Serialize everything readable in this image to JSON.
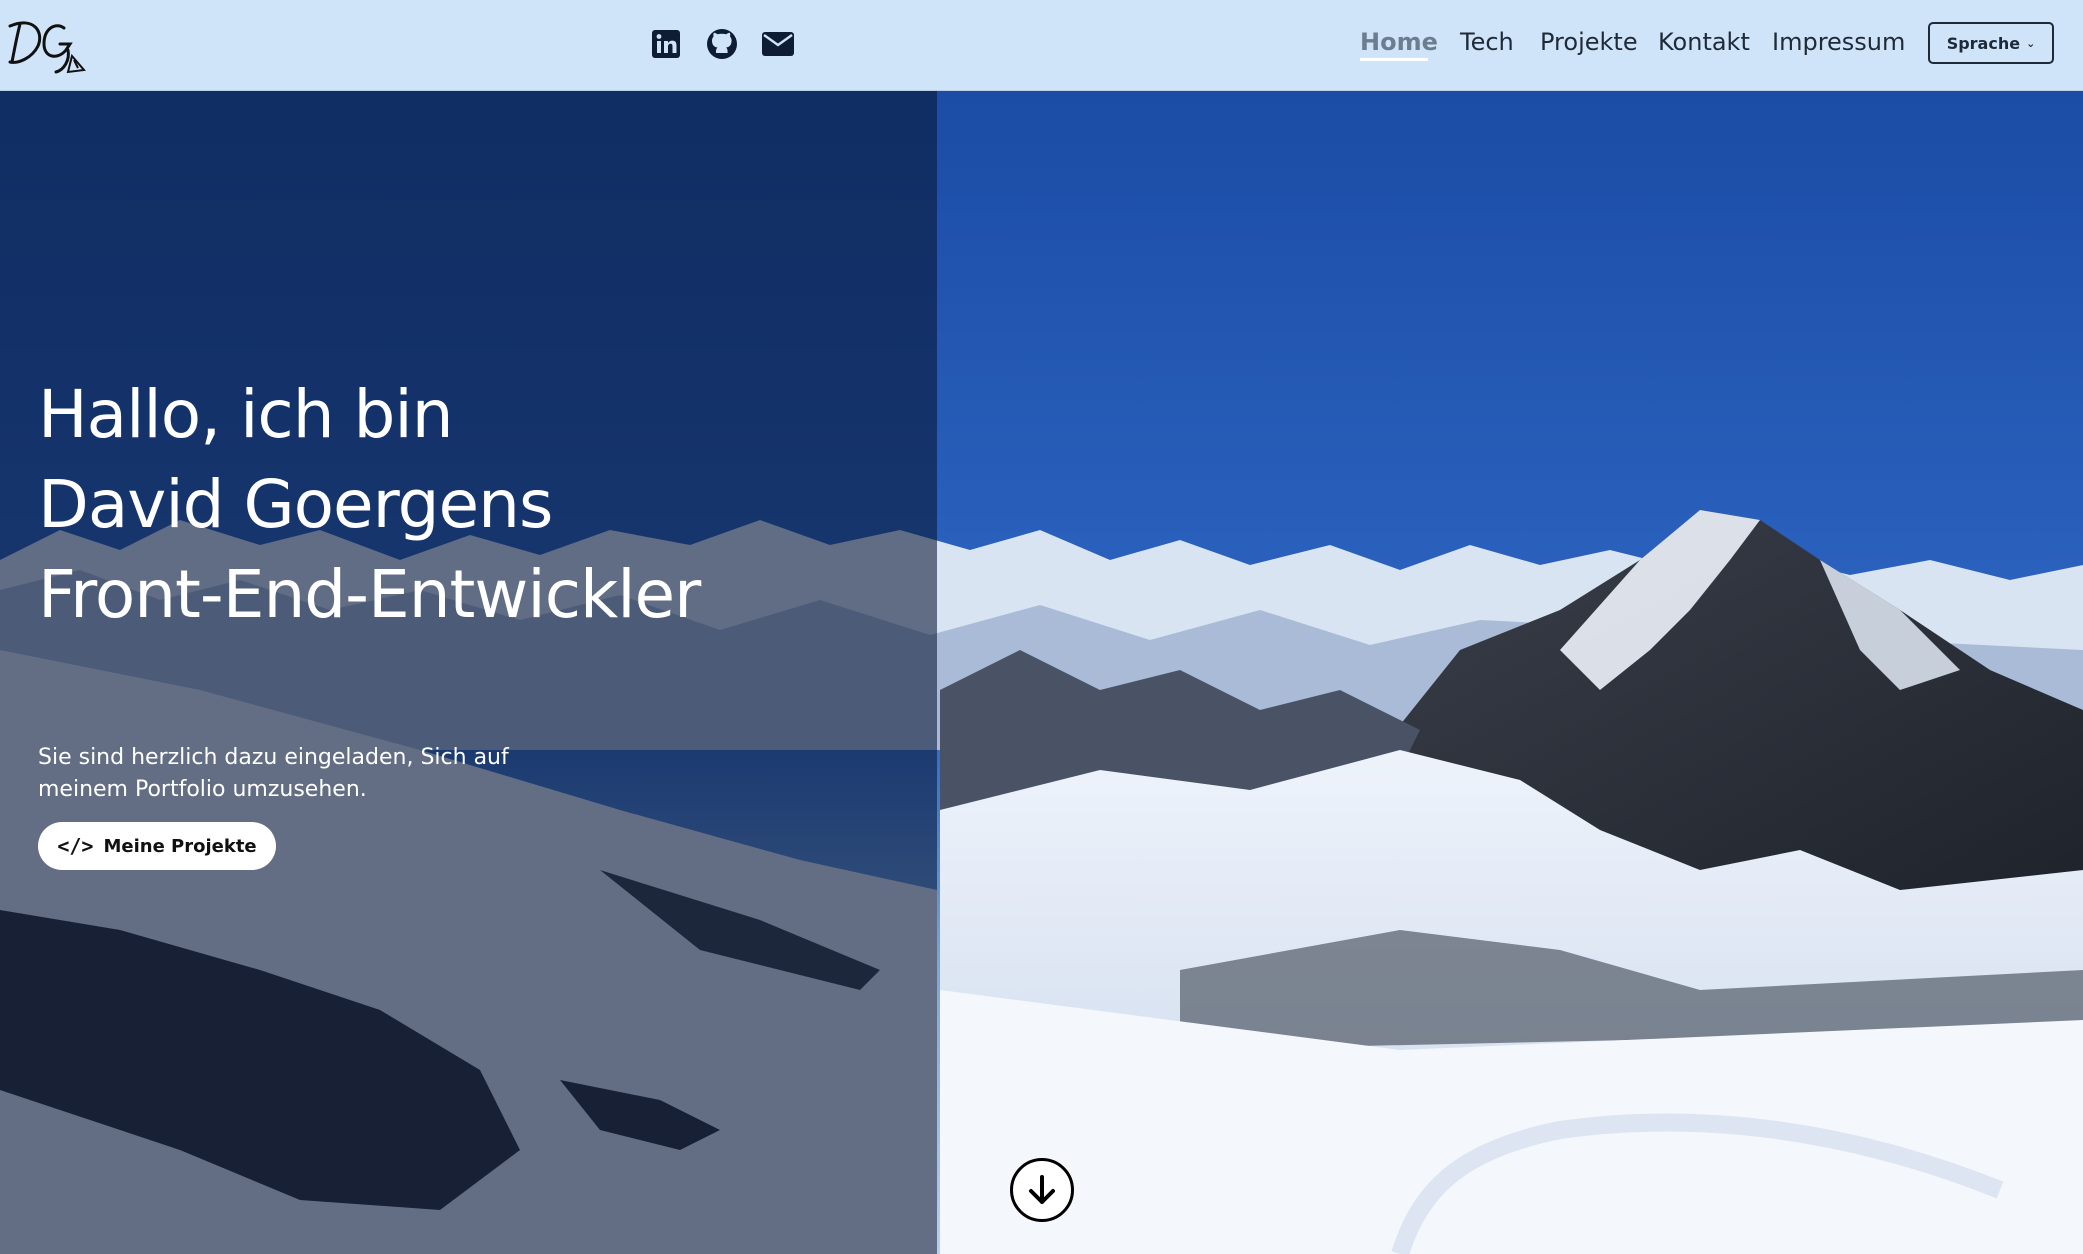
{
  "logo": {
    "text": "DG",
    "icon": "signature-logo"
  },
  "social": [
    {
      "name": "LinkedIn",
      "icon": "linkedin-icon"
    },
    {
      "name": "GitHub",
      "icon": "github-icon"
    },
    {
      "name": "E-Mail",
      "icon": "envelope-icon"
    }
  ],
  "nav": {
    "items": [
      {
        "label": "Home",
        "active": true
      },
      {
        "label": "Tech"
      },
      {
        "label": "Projekte"
      },
      {
        "label": "Kontakt"
      },
      {
        "label": "Impressum"
      }
    ],
    "language_button": "Sprache",
    "language_icon": "chevron-down-icon"
  },
  "hero": {
    "title_lines": [
      "Hallo, ich bin",
      "David Goergens",
      "Front-End-Entwickler"
    ],
    "subtitle_lines": [
      "Sie sind herzlich dazu eingeladen, Sich auf",
      "meinem Portfolio umzusehen."
    ],
    "cta_label": "Meine Projekte",
    "cta_icon": "code-icon",
    "scroll_icon": "arrow-down-icon",
    "background": "snowy-mountain-landscape"
  },
  "colors": {
    "header_bg": "#d0e4f9",
    "text_dark": "#1e2a38",
    "nav_active": "#6b7d8e",
    "overlay": "#081634",
    "sky_top": "#1c4fa8",
    "sky_horizon": "#7aa6dc"
  }
}
